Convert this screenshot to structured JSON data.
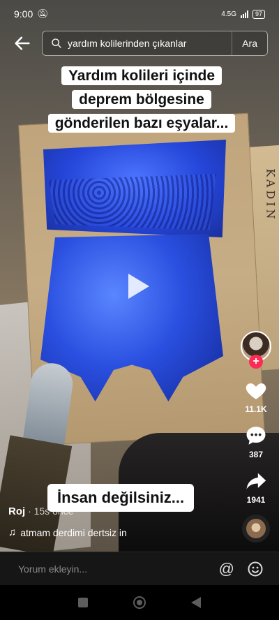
{
  "status_bar": {
    "time": "9:00",
    "network": "4.5G",
    "battery": "97"
  },
  "search": {
    "query": "yardım kolilerinden çıkanlar",
    "button_label": "Ara"
  },
  "video": {
    "caption_lines": [
      "Yardım kolileri içinde",
      "deprem bölgesine",
      "gönderilen bazı eşyalar..."
    ],
    "sticker_text": "İnsan değilsiniz..."
  },
  "actions": {
    "likes": "11.1K",
    "comments": "387",
    "shares": "1941"
  },
  "author": {
    "name": "Roj",
    "time": "· 15s önce"
  },
  "music": {
    "title": "atmam derdimi dertsiz in"
  },
  "comment_bar": {
    "placeholder": "Yorum ekleyin..."
  },
  "colors": {
    "accent": "#fe2c55",
    "background": "#000000"
  }
}
